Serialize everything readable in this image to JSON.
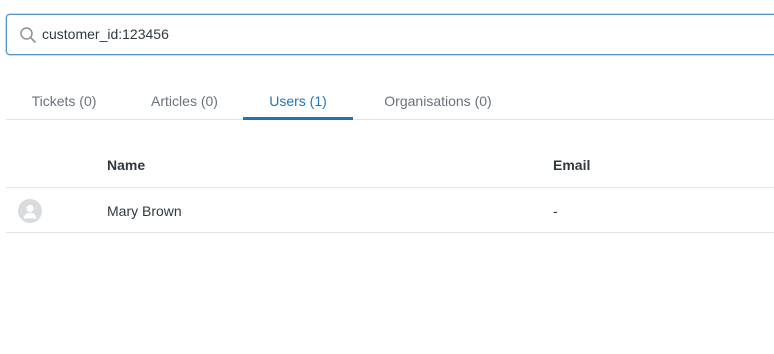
{
  "search": {
    "value": "customer_id:123456",
    "icon": "search-icon"
  },
  "tabs": [
    {
      "label": "Tickets (0)",
      "active": false
    },
    {
      "label": "Articles (0)",
      "active": false
    },
    {
      "label": "Users (1)",
      "active": true
    },
    {
      "label": "Organisations (0)",
      "active": false
    }
  ],
  "table": {
    "headers": {
      "name": "Name",
      "email": "Email"
    },
    "rows": [
      {
        "avatar": "user-icon",
        "name": "Mary Brown",
        "email": "-"
      }
    ]
  },
  "colors": {
    "accent": "#1f73b7",
    "border": "#e1e5e8",
    "text": "#2f3941",
    "muted": "#68737d"
  }
}
